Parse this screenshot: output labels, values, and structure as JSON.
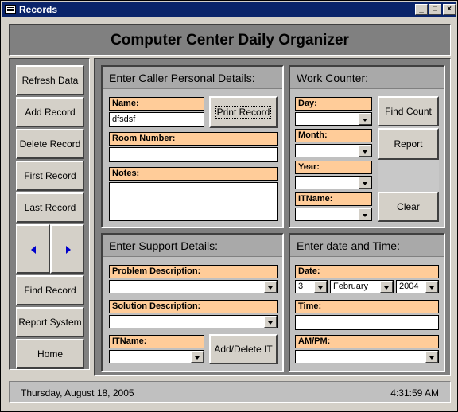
{
  "window": {
    "title": "Records"
  },
  "header": {
    "title": "Computer Center Daily Organizer"
  },
  "nav": {
    "refresh": "Refresh Data",
    "add": "Add Record",
    "delete": "Delete Record",
    "first": "First Record",
    "last": "Last Record",
    "find": "Find Record",
    "report": "Report System",
    "home": "Home"
  },
  "caller": {
    "heading": "Enter Caller Personal Details:",
    "name_label": "Name:",
    "name_value": "dfsdsf",
    "print_button": "Print Record",
    "room_label": "Room Number:",
    "room_value": "",
    "notes_label": "Notes:",
    "notes_value": ""
  },
  "counter": {
    "heading": "Work Counter:",
    "day_label": "Day:",
    "month_label": "Month:",
    "year_label": "Year:",
    "itname_label": "ITName:",
    "find_count": "Find Count",
    "report": "Report",
    "clear": "Clear"
  },
  "support": {
    "heading": "Enter Support Details:",
    "problem_label": "Problem Description:",
    "solution_label": "Solution Description:",
    "itname_label": "ITName:",
    "add_delete_it": "Add/Delete IT"
  },
  "datetime": {
    "heading": "Enter date and Time:",
    "date_label": "Date:",
    "day_value": "3",
    "month_value": "February",
    "year_value": "2004",
    "time_label": "Time:",
    "time_value": "",
    "ampm_label": "AM/PM:"
  },
  "status": {
    "date": "Thursday, August 18, 2005",
    "time": "4:31:59 AM"
  }
}
